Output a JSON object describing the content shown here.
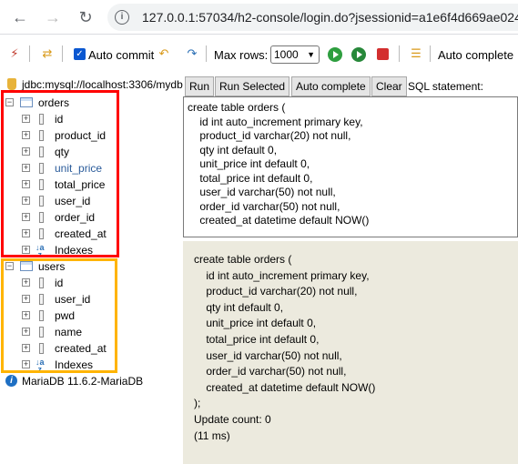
{
  "browser": {
    "back_icon": "arrow-left-icon",
    "forward_icon": "arrow-right-icon",
    "reload_icon": "reload-icon",
    "url": "127.0.0.1:57034/h2-console/login.do?jsessionid=a1e6f4d669ae024"
  },
  "toolbar": {
    "auto_commit_label": "Auto commit",
    "max_rows_label": "Max rows:",
    "max_rows_value": "1000",
    "auto_complete_label": "Auto complete"
  },
  "tree": {
    "connection": "jdbc:mysql://localhost:3306/mydb",
    "orders": {
      "name": "orders",
      "columns": [
        "id",
        "product_id",
        "qty",
        "unit_price",
        "total_price",
        "user_id",
        "order_id",
        "created_at"
      ],
      "indexes": "Indexes"
    },
    "users": {
      "name": "users",
      "columns": [
        "id",
        "user_id",
        "pwd",
        "name",
        "created_at"
      ],
      "indexes": "Indexes"
    },
    "version": "MariaDB 11.6.2-MariaDB"
  },
  "buttons": {
    "run": "Run",
    "run_selected": "Run Selected",
    "auto_complete": "Auto complete",
    "clear": "Clear",
    "sql_statement": "SQL statement:"
  },
  "editor": {
    "lines": [
      "create table orders (",
      "    id int auto_increment primary key,",
      "    product_id varchar(20) not null,",
      "    qty int default 0,",
      "    unit_price int default 0,",
      "    total_price int default 0,",
      "    user_id varchar(50) not null,",
      "    order_id varchar(50) not null,",
      "    created_at datetime default NOW()"
    ]
  },
  "result": {
    "lines": [
      "create table orders (",
      "    id int auto_increment primary key,",
      "    product_id varchar(20) not null,",
      "    qty int default 0,",
      "    unit_price int default 0,",
      "    total_price int default 0,",
      "    user_id varchar(50) not null,",
      "    order_id varchar(50) not null,",
      "    created_at datetime default NOW()",
      ");",
      "Update count: 0",
      "(11 ms)"
    ]
  },
  "colors": {
    "highlight_orders": "#ff0000",
    "highlight_users": "#ffb400",
    "result_background": "#eceade",
    "column_unit_price": "#2a5b9a"
  }
}
